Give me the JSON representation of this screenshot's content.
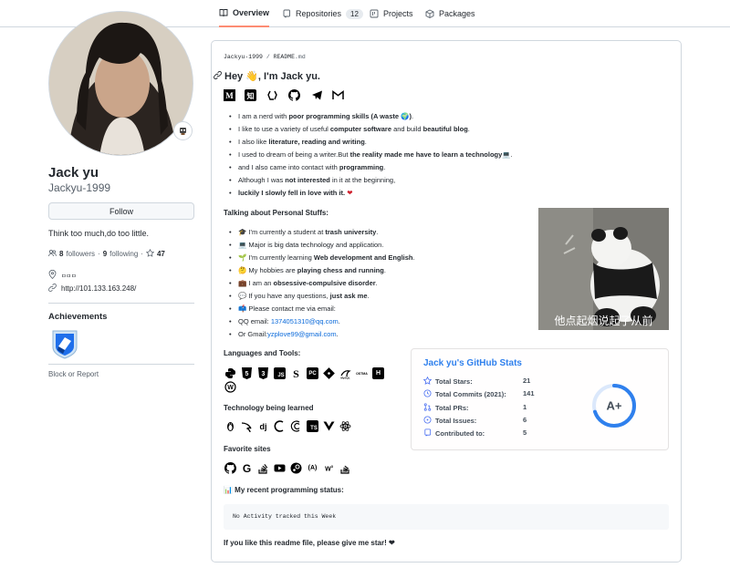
{
  "nav": {
    "tabs": [
      {
        "label": "Overview",
        "icon": "book-icon",
        "active": true
      },
      {
        "label": "Repositories",
        "icon": "repo-icon",
        "count": "12"
      },
      {
        "label": "Projects",
        "icon": "project-icon"
      },
      {
        "label": "Packages",
        "icon": "package-icon"
      }
    ]
  },
  "profile": {
    "name": "Jack yu",
    "login": "Jackyu-1999",
    "follow_label": "Follow",
    "bio": "Think too much,do too little.",
    "followers_count": "8",
    "followers_label": "followers",
    "following_count": "9",
    "following_label": "following",
    "separator": "·",
    "stars_count": "47",
    "location": "ㅁㅁㅁ",
    "website": "http://101.133.163.248/",
    "achievements_title": "Achievements",
    "block_label": "Block or Report"
  },
  "readme": {
    "path_owner": "Jackyu-1999",
    "path_sep": " / ",
    "path_file": "README",
    "path_ext": ".md",
    "greeting": "Hey 👋, I'm Jack yu.",
    "socials": [
      "medium-icon",
      "zhihu-icon",
      "codewars-icon",
      "github-icon",
      "telegram-icon",
      "gmail-icon"
    ],
    "intro": [
      {
        "pre": "I am a nerd with ",
        "bold": "poor programming skills (A waste 🌍)",
        "post": "."
      },
      {
        "pre": "I like to use a variety of useful ",
        "bold": "computer software",
        "post": " and build ",
        "bold2": "beautiful blog",
        "post2": "."
      },
      {
        "pre": "I also like ",
        "bold": "literature, reading and writing",
        "post": "."
      },
      {
        "pre": "I used to dream of being a writer.But ",
        "bold": "the reality made me have to learn a technology💻",
        "post": "."
      },
      {
        "pre": "and I also came into contact with ",
        "bold": "programming",
        "post": "."
      },
      {
        "pre": "Although I was ",
        "bold": "not interested",
        "post": " in it at the beginning,"
      },
      {
        "pre": "",
        "bold": "luckily I slowly fell in love with it.",
        "post": " ❤"
      }
    ],
    "personal_title": "Talking about Personal Stuffs:",
    "personal": [
      {
        "pre": "🎓 I'm currently a student at ",
        "bold": "trash university",
        "post": "."
      },
      {
        "pre": "💻 Major is big data technology and application.",
        "bold": "",
        "post": ""
      },
      {
        "pre": "🌱 I'm currently learning ",
        "bold": "Web development and English",
        "post": "."
      },
      {
        "pre": "🤔 My hobbies are ",
        "bold": "playing chess and running",
        "post": "."
      },
      {
        "pre": "💼 I am an ",
        "bold": "obsessive-compulsive disorder",
        "post": "."
      },
      {
        "pre": "💬 If you have any questions, ",
        "bold": "just ask me",
        "post": "."
      },
      {
        "pre": "📫 Please contact me via email:",
        "bold": "",
        "post": ""
      },
      {
        "pre": "QQ email: ",
        "link": "1374051310@qq.com",
        "post": "."
      },
      {
        "pre": "Or Gmail:",
        "link": "yzplove99@gmail.com",
        "post": "."
      }
    ],
    "panda_caption": "他点起烟说起了从前",
    "tools_title": "Languages and Tools:",
    "tools": [
      "python-icon",
      "html5-icon",
      "css3-icon",
      "javascript-icon",
      "sass-icon",
      "pycharm-icon",
      "git-icon",
      "mysql-icon",
      "postman-icon",
      "heroku-icon",
      "wordpress-icon"
    ],
    "learning_title": "Technology being learned",
    "learning": [
      "linux-icon",
      "kali-icon",
      "django-icon",
      "clojure-icon",
      "jest-icon",
      "typescript-icon",
      "vue-icon",
      "react-icon"
    ],
    "sites_title": "Favorite sites",
    "sites": [
      "github-icon",
      "google-icon",
      "stackoverflow-icon",
      "youtube-icon",
      "steam-icon",
      "angular-icon",
      "w3schools-icon",
      "stackexchange-icon"
    ],
    "status_title": "📊 My recent programming status:",
    "activity": "No Activity tracked this Week",
    "final": "If you like this readme file, please give me star! ❤"
  },
  "stats_card": {
    "title": "Jack yu's GitHub Stats",
    "rows": [
      {
        "icon": "star-icon",
        "label": "Total Stars:",
        "value": "21"
      },
      {
        "icon": "history-icon",
        "label": "Total Commits (2021):",
        "value": "141"
      },
      {
        "icon": "pr-icon",
        "label": "Total PRs:",
        "value": "1"
      },
      {
        "icon": "issue-icon",
        "label": "Total Issues:",
        "value": "6"
      },
      {
        "icon": "repo-icon",
        "label": "Contributed to:",
        "value": "5"
      }
    ],
    "grade": "A+",
    "ring_progress": 0.7,
    "accent": "#2f80ed"
  }
}
